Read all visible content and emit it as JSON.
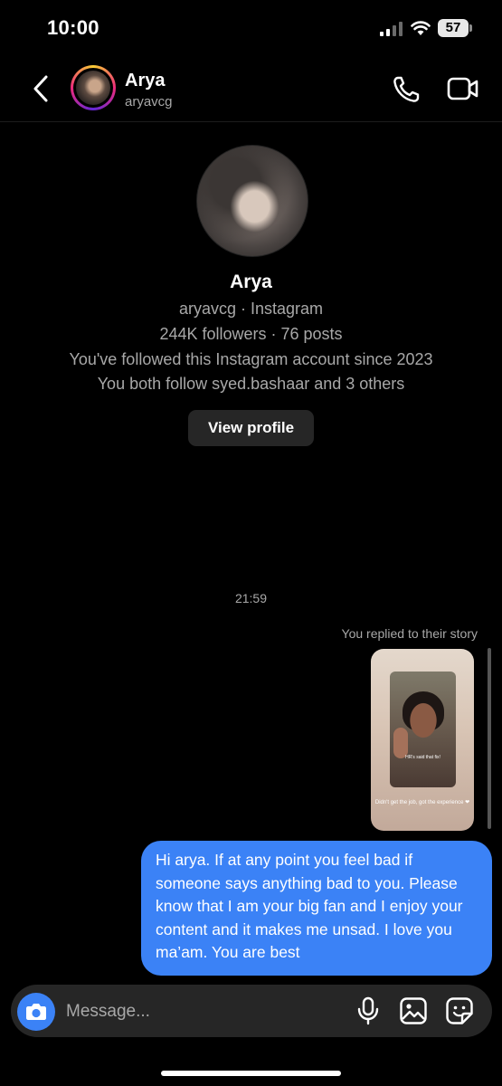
{
  "status_bar": {
    "time": "10:00",
    "battery": "57"
  },
  "header": {
    "name": "Arya",
    "handle": "aryavcg"
  },
  "profile": {
    "name": "Arya",
    "subtitle": "aryavcg · Instagram",
    "stats": "244K followers · 76 posts",
    "followed_since": "You've followed this Instagram account since 2023",
    "mutuals": "You both follow syed.bashaar and 3 others",
    "view_profile_label": "View profile"
  },
  "thread": {
    "timestamp": "21:59",
    "story_reply_label": "You replied to their story",
    "story": {
      "caption": "HR's said that fix!",
      "text": "Didn't get the job, got the experience ❤"
    },
    "message": "Hi arya. If at any point you feel bad if someone says anything bad to you. Please know that I am your big fan and I enjoy your content and it makes me unsad. I love you ma’am. You are best"
  },
  "composer": {
    "placeholder": "Message..."
  },
  "colors": {
    "accent": "#3b82f6",
    "background": "#000000",
    "surface": "#262626",
    "muted": "#a8a8a8"
  },
  "icons": [
    "back-icon",
    "phone-icon",
    "video-icon",
    "camera-icon",
    "microphone-icon",
    "gallery-icon",
    "sticker-icon",
    "signal-icon",
    "wifi-icon",
    "battery-icon"
  ]
}
